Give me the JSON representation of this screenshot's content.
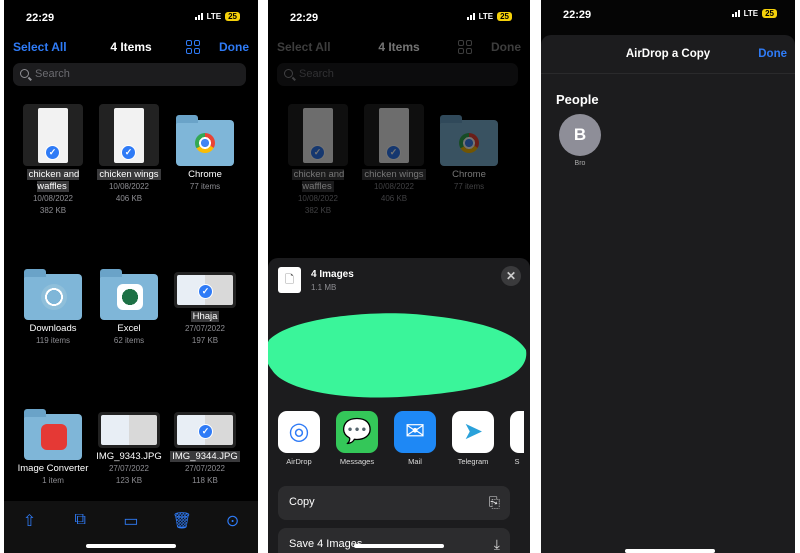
{
  "status": {
    "time": "22:29",
    "network": "LTE",
    "battery": "25"
  },
  "files": {
    "select_all": "Select All",
    "title": "4 Items",
    "done": "Done",
    "search_placeholder": "Search",
    "items": [
      {
        "name": "chicken and waffles",
        "line1": "10/08/2022",
        "line2": "382 KB",
        "kind": "doc",
        "selected": true
      },
      {
        "name": "chicken wings",
        "line1": "10/08/2022",
        "line2": "406 KB",
        "kind": "doc",
        "selected": true
      },
      {
        "name": "Chrome",
        "line1": "77 items",
        "line2": "",
        "kind": "folder",
        "app": "chrome",
        "selected": false
      },
      {
        "name": "Downloads",
        "line1": "119 items",
        "line2": "",
        "kind": "folder",
        "app": "downloads",
        "selected": false
      },
      {
        "name": "Excel",
        "line1": "62 items",
        "line2": "",
        "kind": "folder",
        "app": "excel",
        "selected": false
      },
      {
        "name": "Hhaja",
        "line1": "27/07/2022",
        "line2": "197 KB",
        "kind": "image",
        "selected": true
      },
      {
        "name": "Image Converter",
        "line1": "1 item",
        "line2": "",
        "kind": "folder",
        "app": "imageconverter",
        "selected": false
      },
      {
        "name": "IMG_9343.JPG",
        "line1": "27/07/2022",
        "line2": "123 KB",
        "kind": "image",
        "selected": false
      },
      {
        "name": "IMG_9344.JPG",
        "line1": "27/07/2022",
        "line2": "118 KB",
        "kind": "image",
        "selected": true
      }
    ],
    "toolbar": [
      "share-icon",
      "duplicate-icon",
      "folder-icon",
      "trash-icon",
      "more-icon"
    ]
  },
  "share": {
    "title": "4 Images",
    "size": "1.1 MB",
    "close": "✕",
    "apps": [
      {
        "label": "AirDrop",
        "color": "#ffffff"
      },
      {
        "label": "Messages",
        "color": "#34c759"
      },
      {
        "label": "Mail",
        "color": "#1e88f5"
      },
      {
        "label": "Telegram",
        "color": "#ffffff"
      },
      {
        "label": "S",
        "color": "#ffffff"
      }
    ],
    "actions": [
      {
        "label": "Copy",
        "icon": "copy-icon"
      },
      {
        "label": "Save 4 Images",
        "icon": "save-icon"
      }
    ],
    "redaction_color": "#3af59a"
  },
  "airdrop": {
    "title": "AirDrop a Copy",
    "done": "Done",
    "section": "People",
    "person_initial": "B",
    "person_name": "Bro"
  },
  "colors": {
    "accent": "#2f7bf6",
    "background": "#000000",
    "sheet": "#1c1c1e"
  }
}
